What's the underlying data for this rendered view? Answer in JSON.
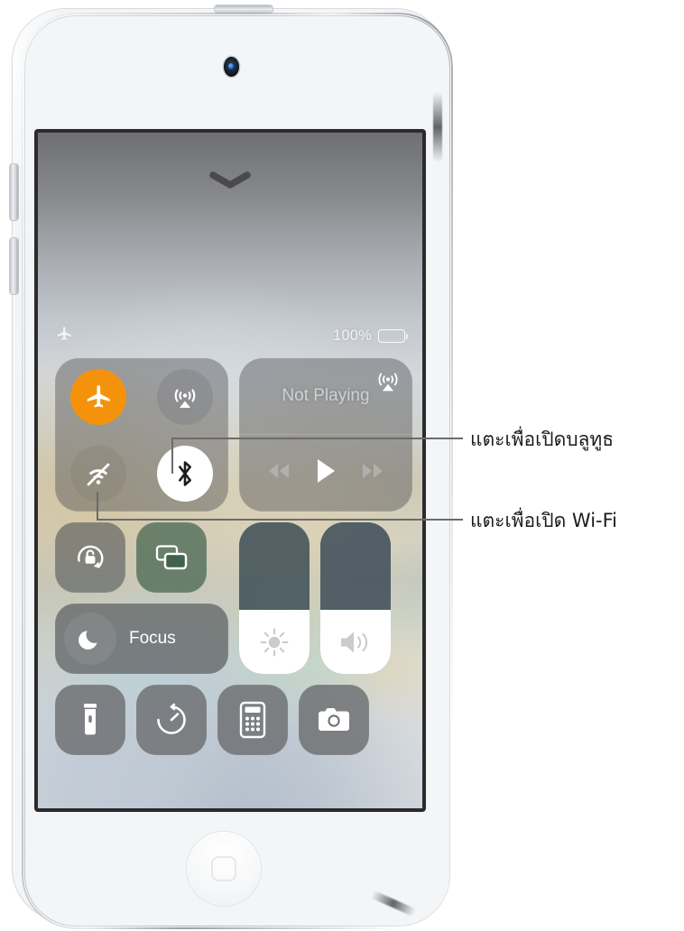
{
  "device": {
    "name": "iPod touch",
    "color_body": "#f4f5f7",
    "camera_label": "front-camera",
    "home_button_label": "home-button",
    "buttons": [
      "volume-up",
      "volume-down",
      "sleep-wake"
    ]
  },
  "screen": {
    "grabber_hint": "chevron-down",
    "wallpaper_colors": [
      "#6e7073",
      "#c3c8ce",
      "#c8c6bb",
      "#d9e0da",
      "#e4e5e6"
    ]
  },
  "status_bar": {
    "airplane_icon": "airplane-icon",
    "battery_percent": "100%",
    "battery_icon": "battery-full-icon"
  },
  "control_center": {
    "connectivity": {
      "name": "connectivity-panel",
      "toggles": [
        {
          "id": "airplane-mode",
          "label": "Airplane Mode",
          "icon": "airplane-icon",
          "state": "on",
          "color": "#f5920b"
        },
        {
          "id": "airdrop",
          "label": "AirDrop",
          "icon": "airdrop-icon",
          "state": "off",
          "color": "#7c7c80"
        },
        {
          "id": "wifi",
          "label": "Wi-Fi",
          "icon": "wifi-slash-icon",
          "state": "off",
          "color": "#807c70"
        },
        {
          "id": "bluetooth",
          "label": "Bluetooth",
          "icon": "bluetooth-icon",
          "state": "on",
          "color": "#ffffff"
        }
      ]
    },
    "media": {
      "name": "now-playing-panel",
      "title": "Not Playing",
      "airplay_icon": "airplay-audio-icon",
      "controls": [
        {
          "id": "rewind",
          "label": "Rewind",
          "icon": "rewind-icon"
        },
        {
          "id": "play",
          "label": "Play",
          "icon": "play-icon"
        },
        {
          "id": "fast-forward",
          "label": "Fast Forward",
          "icon": "fast-forward-icon"
        }
      ]
    },
    "tiles": [
      {
        "id": "rotation-lock",
        "label": "Portrait Orientation Lock",
        "icon": "rotation-lock-icon",
        "state": "off"
      },
      {
        "id": "screen-mirroring",
        "label": "Screen Mirroring",
        "icon": "screen-mirroring-icon",
        "state": "highlighted"
      }
    ],
    "focus": {
      "id": "focus",
      "label": "Focus",
      "icon": "moon-icon",
      "state": "off"
    },
    "sliders": [
      {
        "id": "brightness",
        "label": "Brightness",
        "icon": "brightness-icon",
        "value": 42
      },
      {
        "id": "volume",
        "label": "Volume",
        "icon": "speaker-wave-icon",
        "value": 42
      }
    ],
    "shortcuts": [
      {
        "id": "flashlight",
        "label": "Flashlight",
        "icon": "flashlight-icon"
      },
      {
        "id": "timer",
        "label": "Timer",
        "icon": "timer-icon"
      },
      {
        "id": "calculator",
        "label": "Calculator",
        "icon": "calculator-icon"
      },
      {
        "id": "camera",
        "label": "Camera",
        "icon": "camera-icon"
      }
    ]
  },
  "callouts": [
    {
      "id": "bluetooth-callout",
      "text": "แตะเพื่อเปิดบลูทูธ",
      "target": "bluetooth"
    },
    {
      "id": "wifi-callout",
      "text": "แตะเพื่อเปิด Wi-Fi",
      "target": "wifi"
    }
  ]
}
